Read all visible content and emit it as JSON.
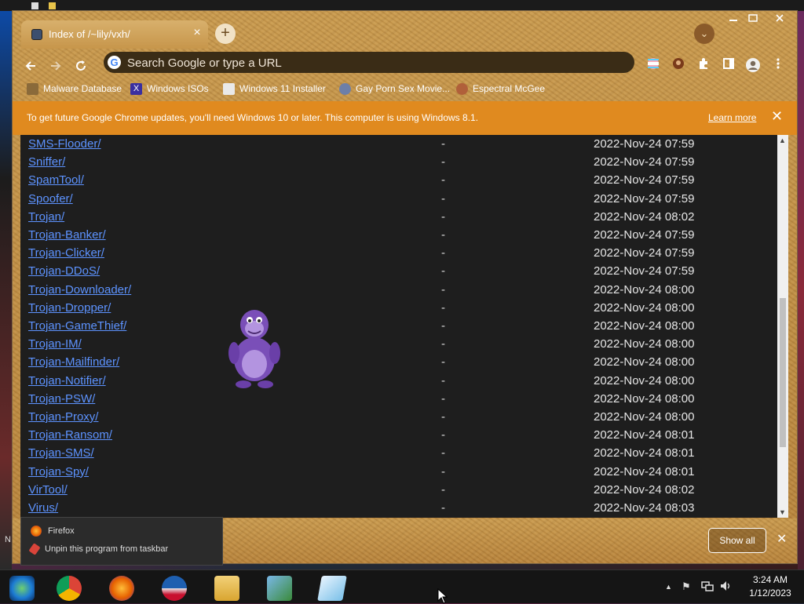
{
  "desktop": {
    "left_label": "N"
  },
  "tab": {
    "title": "Index of /~lily/vxh/",
    "close": "×"
  },
  "toolbar": {
    "new_tab": "+",
    "omnibox_placeholder": "Search Google or type a URL"
  },
  "bookmarks": [
    {
      "label": "Malware Database",
      "icon_color": "#8a6a3a"
    },
    {
      "label": "Windows ISOs",
      "icon_color": "#3a2fa0"
    },
    {
      "label": "Windows 11 Installer",
      "icon_color": "#e9e9e9"
    },
    {
      "label": "Gay Porn Sex Movie...",
      "icon_color": "#6d7fa8"
    },
    {
      "label": "Espectral McGee",
      "icon_color": "#b0603a"
    }
  ],
  "infobar": {
    "message": "To get future Google Chrome updates, you'll need Windows 10 or later. This computer is using Windows 8.1.",
    "learn_more": "Learn more",
    "close": "✕"
  },
  "listing": [
    {
      "name": "SMS-Flooder/",
      "size": "-",
      "date": "2022-Nov-24 07:59"
    },
    {
      "name": "Sniffer/",
      "size": "-",
      "date": "2022-Nov-24 07:59"
    },
    {
      "name": "SpamTool/",
      "size": "-",
      "date": "2022-Nov-24 07:59"
    },
    {
      "name": "Spoofer/",
      "size": "-",
      "date": "2022-Nov-24 07:59"
    },
    {
      "name": "Trojan/",
      "size": "-",
      "date": "2022-Nov-24 08:02"
    },
    {
      "name": "Trojan-Banker/",
      "size": "-",
      "date": "2022-Nov-24 07:59"
    },
    {
      "name": "Trojan-Clicker/",
      "size": "-",
      "date": "2022-Nov-24 07:59"
    },
    {
      "name": "Trojan-DDoS/",
      "size": "-",
      "date": "2022-Nov-24 07:59"
    },
    {
      "name": "Trojan-Downloader/",
      "size": "-",
      "date": "2022-Nov-24 08:00"
    },
    {
      "name": "Trojan-Dropper/",
      "size": "-",
      "date": "2022-Nov-24 08:00"
    },
    {
      "name": "Trojan-GameThief/",
      "size": "-",
      "date": "2022-Nov-24 08:00"
    },
    {
      "name": "Trojan-IM/",
      "size": "-",
      "date": "2022-Nov-24 08:00"
    },
    {
      "name": "Trojan-Mailfinder/",
      "size": "-",
      "date": "2022-Nov-24 08:00"
    },
    {
      "name": "Trojan-Notifier/",
      "size": "-",
      "date": "2022-Nov-24 08:00"
    },
    {
      "name": "Trojan-PSW/",
      "size": "-",
      "date": "2022-Nov-24 08:00"
    },
    {
      "name": "Trojan-Proxy/",
      "size": "-",
      "date": "2022-Nov-24 08:00"
    },
    {
      "name": "Trojan-Ransom/",
      "size": "-",
      "date": "2022-Nov-24 08:01"
    },
    {
      "name": "Trojan-SMS/",
      "size": "-",
      "date": "2022-Nov-24 08:01"
    },
    {
      "name": "Trojan-Spy/",
      "size": "-",
      "date": "2022-Nov-24 08:01"
    },
    {
      "name": "VirTool/",
      "size": "-",
      "date": "2022-Nov-24 08:02"
    },
    {
      "name": "Virus/",
      "size": "-",
      "date": "2022-Nov-24 08:03"
    }
  ],
  "download_bar": {
    "show_all": "Show all",
    "close": "✕"
  },
  "jumplist": {
    "app": "Firefox",
    "unpin": "Unpin this program from taskbar"
  },
  "taskbar": {
    "apps": [
      "start-orb",
      "chrome",
      "firefox",
      "obama-logo",
      "file-explorer",
      "network-app",
      "notepad"
    ],
    "clock_time": "3:24 AM",
    "clock_date": "1/12/2023"
  },
  "colors": {
    "accent_orange": "#e08a1f",
    "link": "#5d93ff",
    "page_bg": "#1e1e1e"
  }
}
